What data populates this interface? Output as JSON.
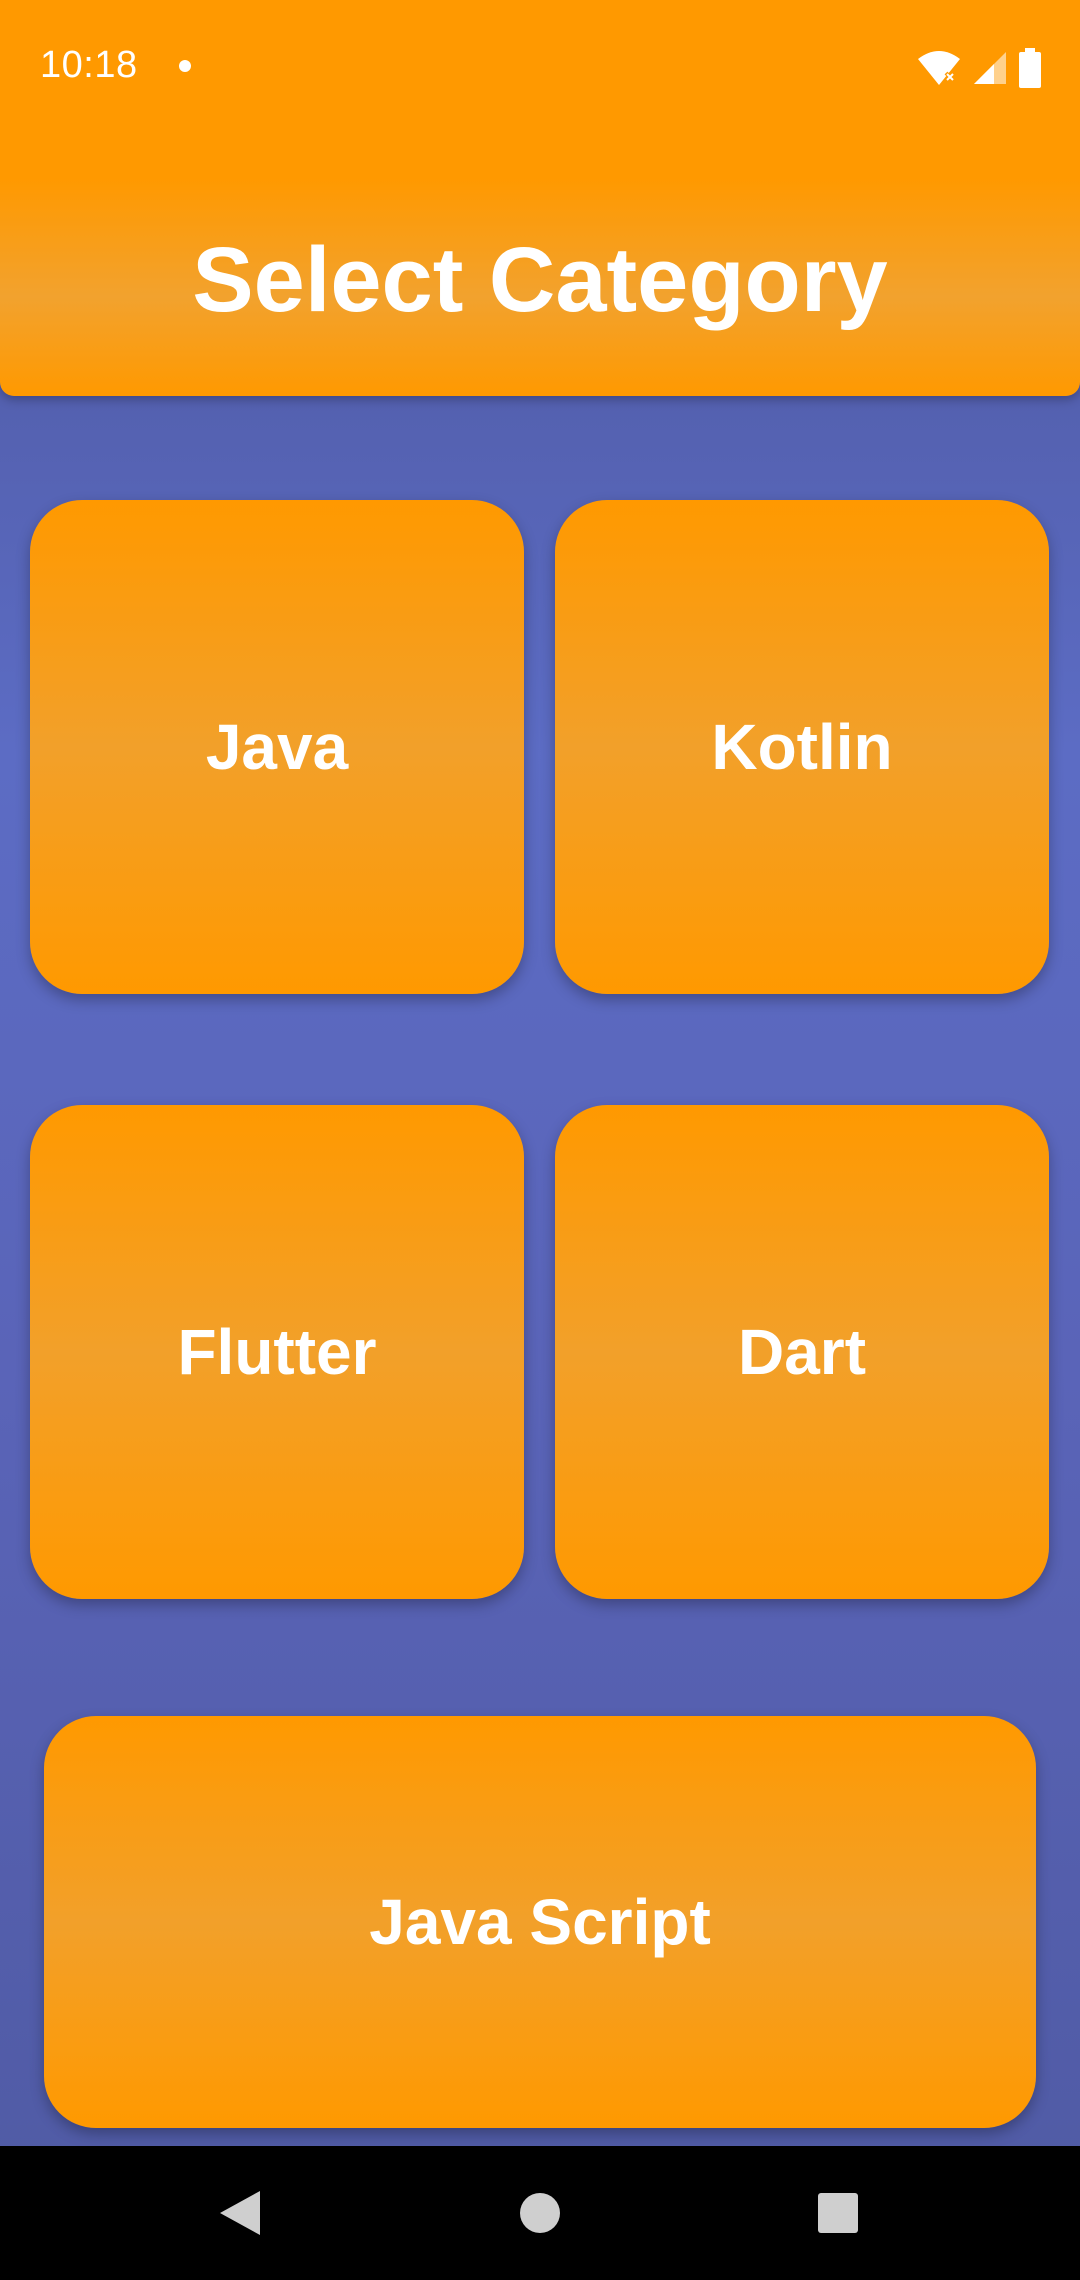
{
  "status_bar": {
    "time": "10:18",
    "icons": [
      "notification-dot",
      "wifi-off-icon",
      "signal-icon",
      "battery-icon"
    ]
  },
  "header": {
    "title": "Select Category"
  },
  "categories": [
    {
      "label": "Java"
    },
    {
      "label": "Kotlin"
    },
    {
      "label": "Flutter"
    },
    {
      "label": "Dart"
    },
    {
      "label": "Java Script"
    }
  ],
  "nav_bar": {
    "icons": [
      "back-icon",
      "home-icon",
      "recents-icon"
    ]
  },
  "colors": {
    "accent": "#ff9900",
    "background": "#5c6cc4",
    "text": "#ffffff"
  }
}
